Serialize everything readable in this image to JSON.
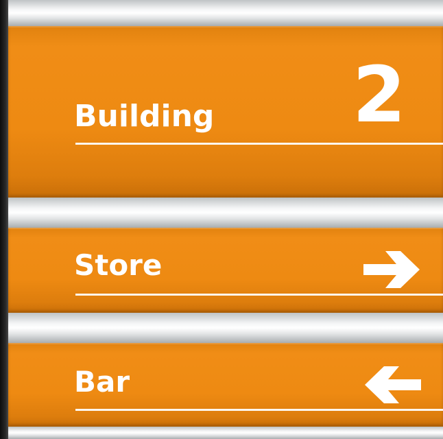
{
  "panels": [
    {
      "label": "Building",
      "number": "2"
    },
    {
      "label": "Store",
      "arrow": "right-arrow-icon"
    },
    {
      "label": "Bar",
      "arrow": "left-arrow-icon"
    }
  ],
  "colors": {
    "panel": "#ee8a12",
    "text": "#ffffff",
    "rail": "#e8eaeb",
    "frame": "#1a1a1a"
  }
}
